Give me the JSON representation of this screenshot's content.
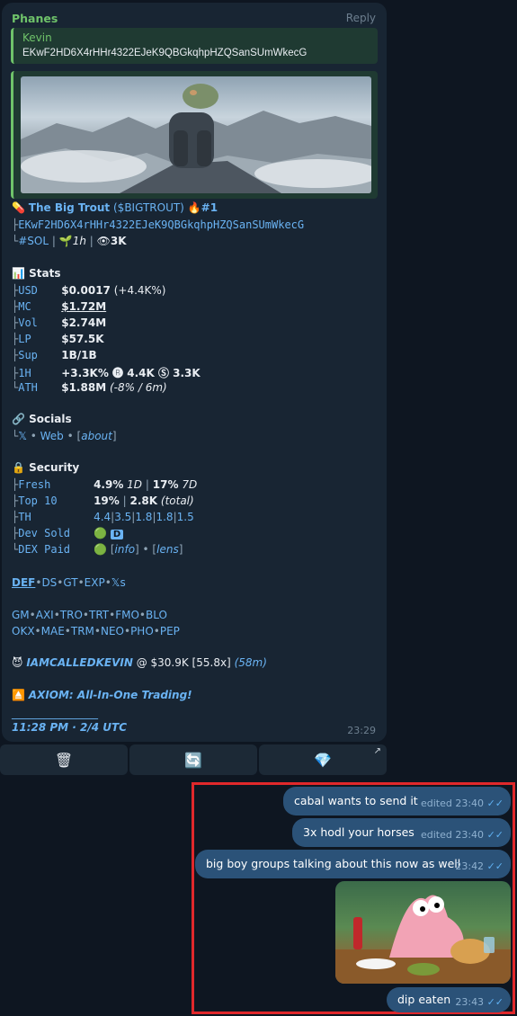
{
  "bot_message": {
    "sender": "Phanes",
    "reply_label": "Reply",
    "quote": {
      "name": "Kevin",
      "text": "EKwF2HD6X4rHHr4322EJeK9QBGkqhpHZQSanSUmWkecG"
    },
    "title_emoji": "💊",
    "token_name": "The Big Trout",
    "token_ticker": "($BIGTROUT)",
    "rank_emoji": "🔥",
    "rank": "#1",
    "address": "EKwF2HD6X4rHHr4322EJeK9QBGkqhpHZQSanSUmWkecG",
    "chain": "#SOL",
    "age_emoji": "🌱",
    "age": "1h",
    "views_emoji": "👁",
    "views": "3K",
    "stats_emoji": "📊",
    "stats_header": "Stats",
    "stats": [
      {
        "key": "USD",
        "value": "$0.0017",
        "extra": "(+4.4K%)"
      },
      {
        "key": "MC",
        "value": "$1.72M",
        "extra": ""
      },
      {
        "key": "Vol",
        "value": "$2.74M",
        "extra": ""
      },
      {
        "key": "LP",
        "value": "$57.5K",
        "extra": ""
      },
      {
        "key": "Sup",
        "value": "1B/1B",
        "extra": ""
      },
      {
        "key": "1H",
        "value": "+3.3K% 🅑 4.4K Ⓢ 3.3K",
        "extra": ""
      },
      {
        "key": "ATH",
        "value": "$1.88M",
        "extra": "(-8% / 6m)"
      }
    ],
    "socials_emoji": "🔗",
    "socials_header": "Socials",
    "socials": {
      "x": "𝕏",
      "web": "Web",
      "about": "about"
    },
    "security_emoji": "🔒",
    "security_header": "Security",
    "security": {
      "fresh_key": "Fresh",
      "fresh_1d": "4.9%",
      "fresh_1d_label": "1D",
      "fresh_7d": "17%",
      "fresh_7d_label": "7D",
      "top10_key": "Top 10",
      "top10_pct": "19%",
      "top10_total": "2.8K",
      "top10_total_label": "(total)",
      "th_key": "TH",
      "th_values": [
        "4.4",
        "3.5",
        "1.8",
        "1.8",
        "1.5"
      ],
      "dev_sold_key": "Dev Sold",
      "dev_sold_icon": "🟢",
      "dev_sold_badge": "D",
      "dex_paid_key": "DEX Paid",
      "dex_paid_icon": "🟢",
      "dex_info": "info",
      "dex_lens": "lens"
    },
    "links_row1": [
      "DEF",
      "DS",
      "GT",
      "EXP",
      "𝕏s"
    ],
    "links_row2": [
      "GM",
      "AXI",
      "TRO",
      "TRT",
      "FMO",
      "BLO"
    ],
    "links_row3": [
      "OKX",
      "MAE",
      "TRM",
      "NEO",
      "PHO",
      "PEP"
    ],
    "caller_emoji": "😈",
    "caller_name": "IAMCALLEDKEVIN",
    "caller_at": "@ $30.9K [55.8x]",
    "caller_time": "(58m)",
    "axiom_emoji": "⏏️",
    "axiom_text": "AXIOM: All-In-One Trading!",
    "divider": "________________",
    "timestamp_line": "11:28 PM · 2/4 UTC",
    "time": "23:29"
  },
  "buttons": [
    {
      "icon": "🗑",
      "name": "trash"
    },
    {
      "icon": "🔄",
      "name": "refresh"
    },
    {
      "icon": "💎",
      "name": "diamond",
      "arrow": "↗"
    }
  ],
  "outgoing": [
    {
      "text": "cabal wants to send it",
      "meta": "edited 23:40"
    },
    {
      "text": "3x hodl your horses",
      "meta": "edited 23:40"
    },
    {
      "text": "big boy groups talking about this now as well",
      "meta": "23:42"
    },
    {
      "text": "dip eaten",
      "meta": "23:43"
    }
  ],
  "read_ticks": "✓✓",
  "colors": {
    "accent": "#6ab3f3",
    "sender": "#6fc36a",
    "bubble_out": "#2b5278",
    "highlight": "#e0282b"
  }
}
